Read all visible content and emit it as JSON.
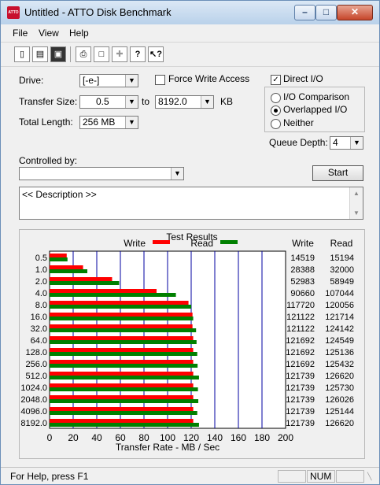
{
  "window": {
    "title": "Untitled - ATTO Disk Benchmark",
    "app_icon": "ATTO"
  },
  "menu": [
    "File",
    "View",
    "Help"
  ],
  "toolbar": [
    "new-icon",
    "open-icon",
    "save-icon",
    "print-icon",
    "print-preview-icon",
    "move-icon",
    "help-icon",
    "context-help-icon"
  ],
  "form": {
    "drive_label": "Drive:",
    "drive_value": "[-e-]",
    "force_write_label": "Force Write Access",
    "transfer_size_label": "Transfer Size:",
    "transfer_from": "0.5",
    "to_label": "to",
    "transfer_to": "8192.0",
    "kb_label": "KB",
    "total_length_label": "Total Length:",
    "total_length_value": "256 MB",
    "direct_io_label": "Direct I/O",
    "io_comparison_label": "I/O Comparison",
    "overlapped_io_label": "Overlapped I/O",
    "neither_label": "Neither",
    "queue_depth_label": "Queue Depth:",
    "queue_depth_value": "4",
    "controlled_by_label": "Controlled by:",
    "controlled_by_value": "",
    "start_label": "Start",
    "description": "<< Description >>"
  },
  "chart_data": {
    "type": "bar",
    "title": "Test Results",
    "xlabel": "Transfer Rate - MB / Sec",
    "xlim": [
      0,
      200
    ],
    "xticks": [
      "0",
      "20",
      "40",
      "60",
      "80",
      "100",
      "120",
      "140",
      "160",
      "180",
      "200"
    ],
    "categories": [
      "0.5",
      "1.0",
      "2.0",
      "4.0",
      "8.0",
      "16.0",
      "32.0",
      "64.0",
      "128.0",
      "256.0",
      "512.0",
      "1024.0",
      "2048.0",
      "4096.0",
      "8192.0"
    ],
    "series": [
      {
        "name": "Write",
        "color": "#ff0000",
        "values": [
          14519,
          28388,
          52983,
          90660,
          117720,
          121122,
          121122,
          121692,
          121692,
          121692,
          121739,
          121739,
          121739,
          121739,
          121739
        ]
      },
      {
        "name": "Read",
        "color": "#008000",
        "values": [
          15194,
          32000,
          58949,
          107044,
          120056,
          121714,
          124142,
          124549,
          125136,
          125432,
          126620,
          125730,
          126026,
          125144,
          126620
        ]
      }
    ],
    "col_write": "Write",
    "col_read": "Read",
    "grid_color": "#0000a0"
  },
  "status": {
    "help": "For Help, press F1",
    "num": "NUM"
  }
}
